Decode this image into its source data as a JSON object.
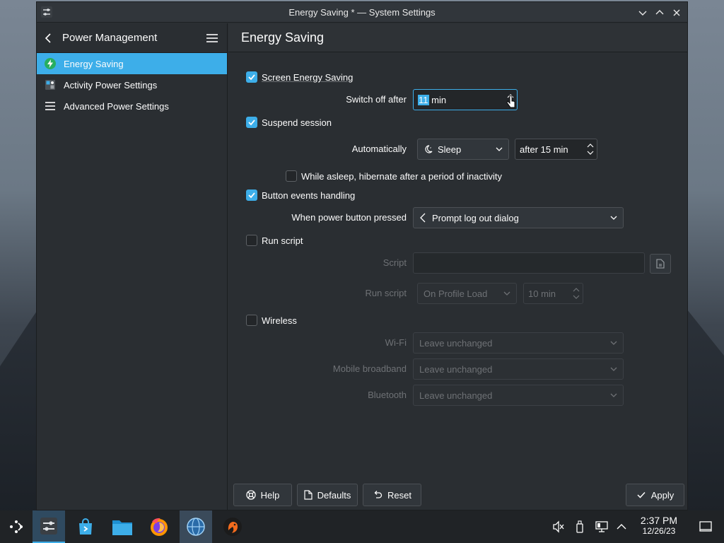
{
  "window": {
    "title": "Energy Saving * — System Settings"
  },
  "sidebar": {
    "back_label": "Power Management",
    "items": [
      {
        "label": "Energy Saving",
        "icon": "energy-icon",
        "active": true
      },
      {
        "label": "Activity Power Settings",
        "icon": "activity-icon",
        "active": false
      },
      {
        "label": "Advanced Power Settings",
        "icon": "list-icon",
        "active": false
      }
    ]
  },
  "page": {
    "title": "Energy Saving"
  },
  "form": {
    "screen": {
      "label": "Screen Energy Saving",
      "checked": true,
      "switch_label": "Switch off after",
      "value": "11",
      "unit": " min"
    },
    "suspend": {
      "label": "Suspend session",
      "checked": true,
      "auto_label": "Automatically",
      "action": "Sleep",
      "after": "after 15 min",
      "hibernate_label": "While asleep, hibernate after a period of inactivity",
      "hibernate_checked": false
    },
    "buttons": {
      "label": "Button events handling",
      "checked": true,
      "power_label": "When power button pressed",
      "power_action": "Prompt log out dialog"
    },
    "script": {
      "label": "Run script",
      "checked": false,
      "script_label": "Script",
      "script_value": "",
      "run_label": "Run script",
      "run_when": "On Profile Load",
      "run_time": "10 min"
    },
    "wireless": {
      "label": "Wireless",
      "checked": false,
      "rows": [
        {
          "label": "Wi-Fi",
          "value": "Leave unchanged"
        },
        {
          "label": "Mobile broadband",
          "value": "Leave unchanged"
        },
        {
          "label": "Bluetooth",
          "value": "Leave unchanged"
        }
      ]
    }
  },
  "footer": {
    "help": "Help",
    "defaults": "Defaults",
    "reset": "Reset",
    "apply": "Apply"
  },
  "taskbar": {
    "time": "2:37 PM",
    "date": "12/26/23"
  },
  "colors": {
    "accent": "#3daee9",
    "window_bg": "#2a2e32",
    "taskbar_bg": "#202326"
  }
}
